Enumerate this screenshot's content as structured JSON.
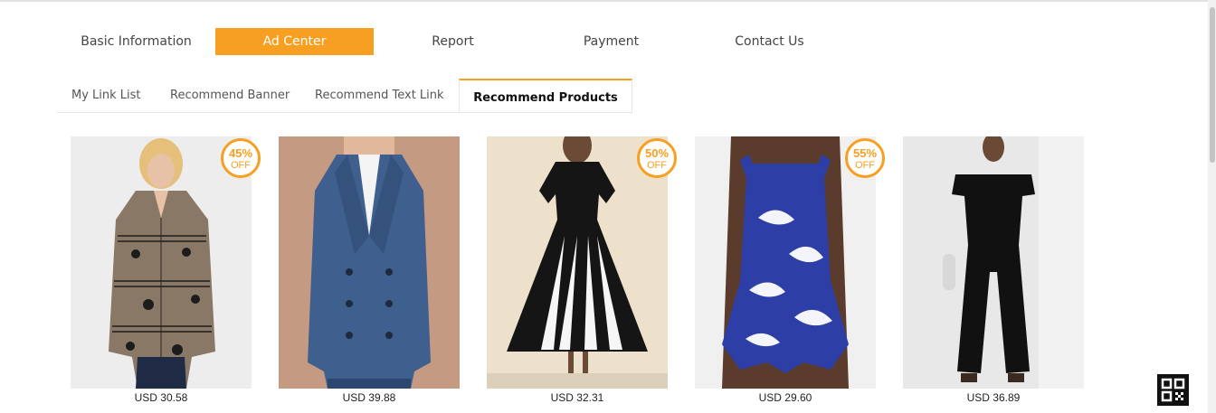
{
  "main_nav": {
    "tabs": [
      {
        "label": "Basic Information",
        "active": false
      },
      {
        "label": "Ad Center",
        "active": true
      },
      {
        "label": "Report",
        "active": false
      },
      {
        "label": "Payment",
        "active": false
      },
      {
        "label": "Contact Us",
        "active": false
      }
    ]
  },
  "sub_nav": {
    "tabs": [
      {
        "label": "My Link List",
        "active": false
      },
      {
        "label": "Recommend Banner",
        "active": false
      },
      {
        "label": "Recommend Text Link",
        "active": false
      },
      {
        "label": "Recommend Products",
        "active": true
      }
    ]
  },
  "products": [
    {
      "price": "USD 30.58",
      "badge": {
        "percent": "45%",
        "off": "OFF"
      },
      "image": "music-print-shirt",
      "colors": {
        "bg": "#ededed",
        "garment": "#8a7866",
        "accent": "#1c1c1c"
      }
    },
    {
      "price": "USD 39.88",
      "badge": null,
      "image": "denim-trench-coat",
      "colors": {
        "bg": "#c59a82",
        "garment": "#3f5f8f",
        "accent": "#1e2a3e"
      }
    },
    {
      "price": "USD 32.31",
      "badge": {
        "percent": "50%",
        "off": "OFF"
      },
      "image": "black-white-dress",
      "colors": {
        "bg": "#eee1cc",
        "garment": "#151515",
        "accent": "#f6f6f6"
      }
    },
    {
      "price": "USD 29.60",
      "badge": {
        "percent": "55%",
        "off": "OFF"
      },
      "image": "blue-print-swimsuit",
      "colors": {
        "bg": "#f0f0f0",
        "garment": "#2d3ea6",
        "accent": "#ffffff"
      }
    },
    {
      "price": "USD 36.89",
      "badge": null,
      "image": "black-jumpsuit",
      "colors": {
        "bg": "#e8e8e8",
        "garment": "#111111",
        "accent": "#f2f2f2"
      }
    }
  ],
  "theme": {
    "accent": "#f69f20"
  },
  "qr_icon": "qr-code-icon"
}
